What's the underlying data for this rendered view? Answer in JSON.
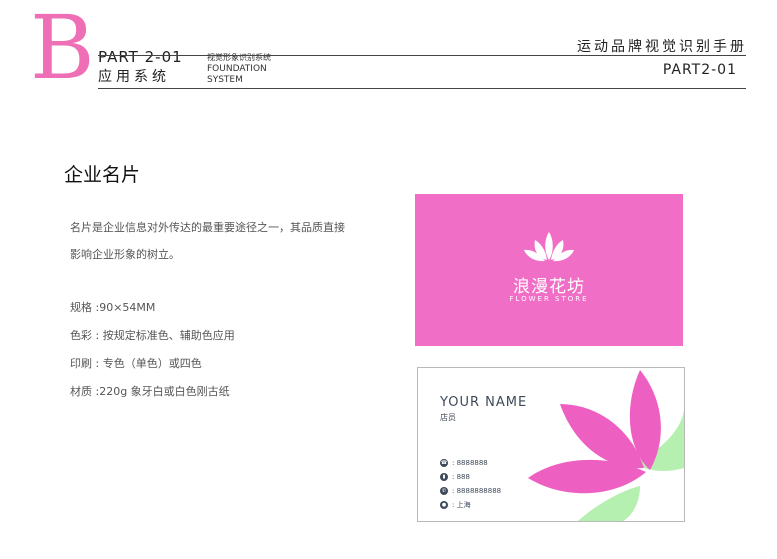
{
  "header": {
    "letter": "B",
    "part_code": "PART 2-01",
    "part_name": "应用系统",
    "system_cn": "视觉形象识别系统",
    "system_en_line1": "FOUNDATION",
    "system_en_line2": "SYSTEM",
    "manual_title": "运动品牌视觉识别手册",
    "manual_part": "PART2-01"
  },
  "section": {
    "title": "企业名片",
    "intro_line1": "名片是企业信息对外传达的最重要途径之一，其品质直接",
    "intro_line2": "影响企业形象的树立。",
    "spec_size": "规格 :90×54MM",
    "spec_color": "色彩 : 按规定标准色、辅助色应用",
    "spec_print": "印刷 : 专色（单色）或四色",
    "spec_material": "材质 :220g 象牙白或白色刚古纸"
  },
  "card_front": {
    "brand_cn": "浪漫花坊",
    "brand_en": "FLOWER STORE",
    "bg_color": "#f06ec6"
  },
  "card_back": {
    "name": "YOUR  NAME",
    "job_title": "店员",
    "contacts": [
      {
        "icon": "phone-icon",
        "text": ": 8888888"
      },
      {
        "icon": "mobile-icon",
        "text": ": 888"
      },
      {
        "icon": "fax-icon",
        "text": ": 8888888888"
      },
      {
        "icon": "location-icon",
        "text": ": 上海"
      }
    ],
    "petal_colors": [
      "#ee5fc2",
      "#b5f0b0"
    ]
  },
  "colors": {
    "accent_pink": "#ee6fb5",
    "text_dark": "#3e4a5a"
  }
}
